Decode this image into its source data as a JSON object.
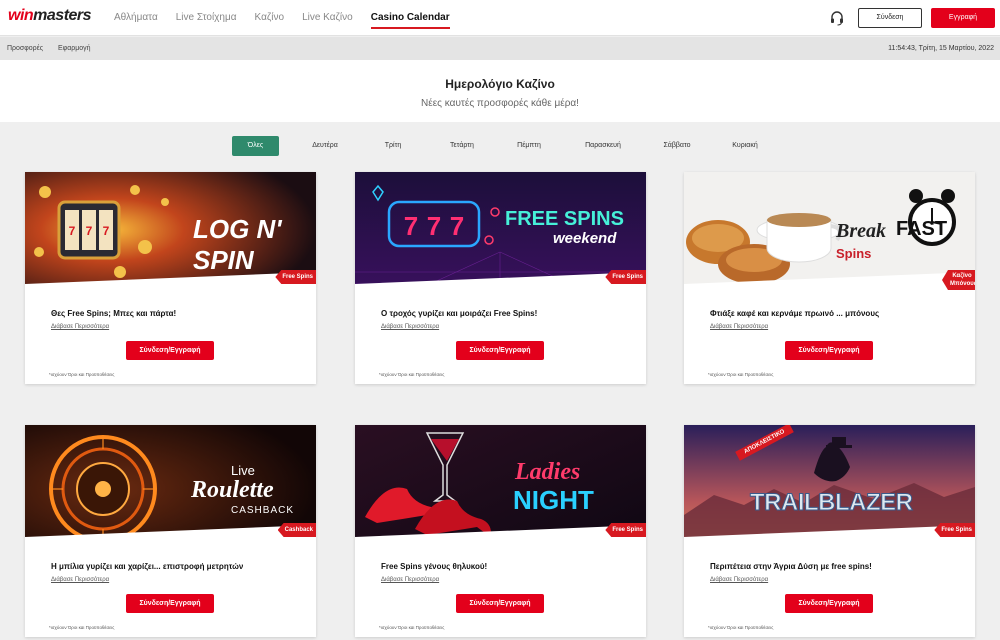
{
  "brand": {
    "logo_win": "win",
    "logo_masters": "masters"
  },
  "nav": {
    "items": [
      {
        "label": "Αθλήματα",
        "active": false
      },
      {
        "label": "Live Στοίχημα",
        "active": false
      },
      {
        "label": "Καζίνο",
        "active": false
      },
      {
        "label": "Live Καζίνο",
        "active": false
      },
      {
        "label": "Casino Calendar",
        "active": true
      }
    ],
    "login_label": "Σύνδεση",
    "register_label": "Εγγραφή",
    "headset_icon": "headset-icon"
  },
  "subnav": {
    "links": [
      "Προσφορές",
      "Εφαρμογή"
    ],
    "datetime": "11:54:43, Τρίτη, 15 Μαρτίου, 2022"
  },
  "hero": {
    "title": "Ημερολόγιο Καζίνο",
    "subtitle": "Νέες καυτές προσφορές κάθε μέρα!"
  },
  "tabs": [
    {
      "label": "Όλες",
      "active": true
    },
    {
      "label": "Δευτέρα",
      "active": false
    },
    {
      "label": "Τρίτη",
      "active": false
    },
    {
      "label": "Τετάρτη",
      "active": false
    },
    {
      "label": "Πέμπτη",
      "active": false
    },
    {
      "label": "Παρασκευή",
      "active": false
    },
    {
      "label": "Σάββατο",
      "active": false
    },
    {
      "label": "Κυριακή",
      "active": false
    }
  ],
  "cards": [
    {
      "art_text": "LOG N' SPIN",
      "badge": "Free Spins",
      "title": "Θες Free Spins; Μπες και πάρτα!",
      "more": "Διάβασε Περισσότερα",
      "cta": "Σύνδεση/Εγγραφή",
      "terms": "*ισχύουν Όροι και Προϋποθέσεις"
    },
    {
      "art_text": "FREE SPINS",
      "art_text2": "weekend",
      "badge": "Free Spins",
      "title": "Ο τροχός γυρίζει και μοιράζει Free Spins!",
      "more": "Διάβασε Περισσότερα",
      "cta": "Σύνδεση/Εγγραφή",
      "terms": "*ισχύουν Όροι και Προϋποθέσεις"
    },
    {
      "art_text": "Break",
      "art_text2": "FAST",
      "art_text3": "Spins",
      "badge": "Καζίνο Μπόνους",
      "title": "Φτιάξε καφέ και κερνάμε πρωινό ... μπόνους",
      "more": "Διάβασε Περισσότερα",
      "cta": "Σύνδεση/Εγγραφή",
      "terms": "*ισχύουν Όροι και Προϋποθέσεις"
    },
    {
      "art_text": "Live",
      "art_text2": "Roulette",
      "art_text3": "CASHBACK",
      "badge": "Cashback",
      "title": "Η μπίλια γυρίζει και χαρίζει... επιστροφή μετρητών",
      "more": "Διάβασε Περισσότερα",
      "cta": "Σύνδεση/Εγγραφή",
      "terms": "*ισχύουν Όροι και Προϋποθέσεις"
    },
    {
      "art_text": "Ladies",
      "art_text2": "NIGHT",
      "badge": "Free Spins",
      "title": "Free Spins γένους θηλυκού!",
      "more": "Διάβασε Περισσότερα",
      "cta": "Σύνδεση/Εγγραφή",
      "terms": "*ισχύουν Όροι και Προϋποθέσεις"
    },
    {
      "art_text": "TRAILBLAZER",
      "art_text2": "ΑΠΟΚΛΕΙΣΤΙΚΟ",
      "badge": "Free Spins",
      "title": "Περιπέτεια στην Άγρια Δύση με free spins!",
      "more": "Διάβασε Περισσότερα",
      "cta": "Σύνδεση/Εγγραφή",
      "terms": "*ισχύουν Όροι και Προϋποθέσεις"
    }
  ]
}
